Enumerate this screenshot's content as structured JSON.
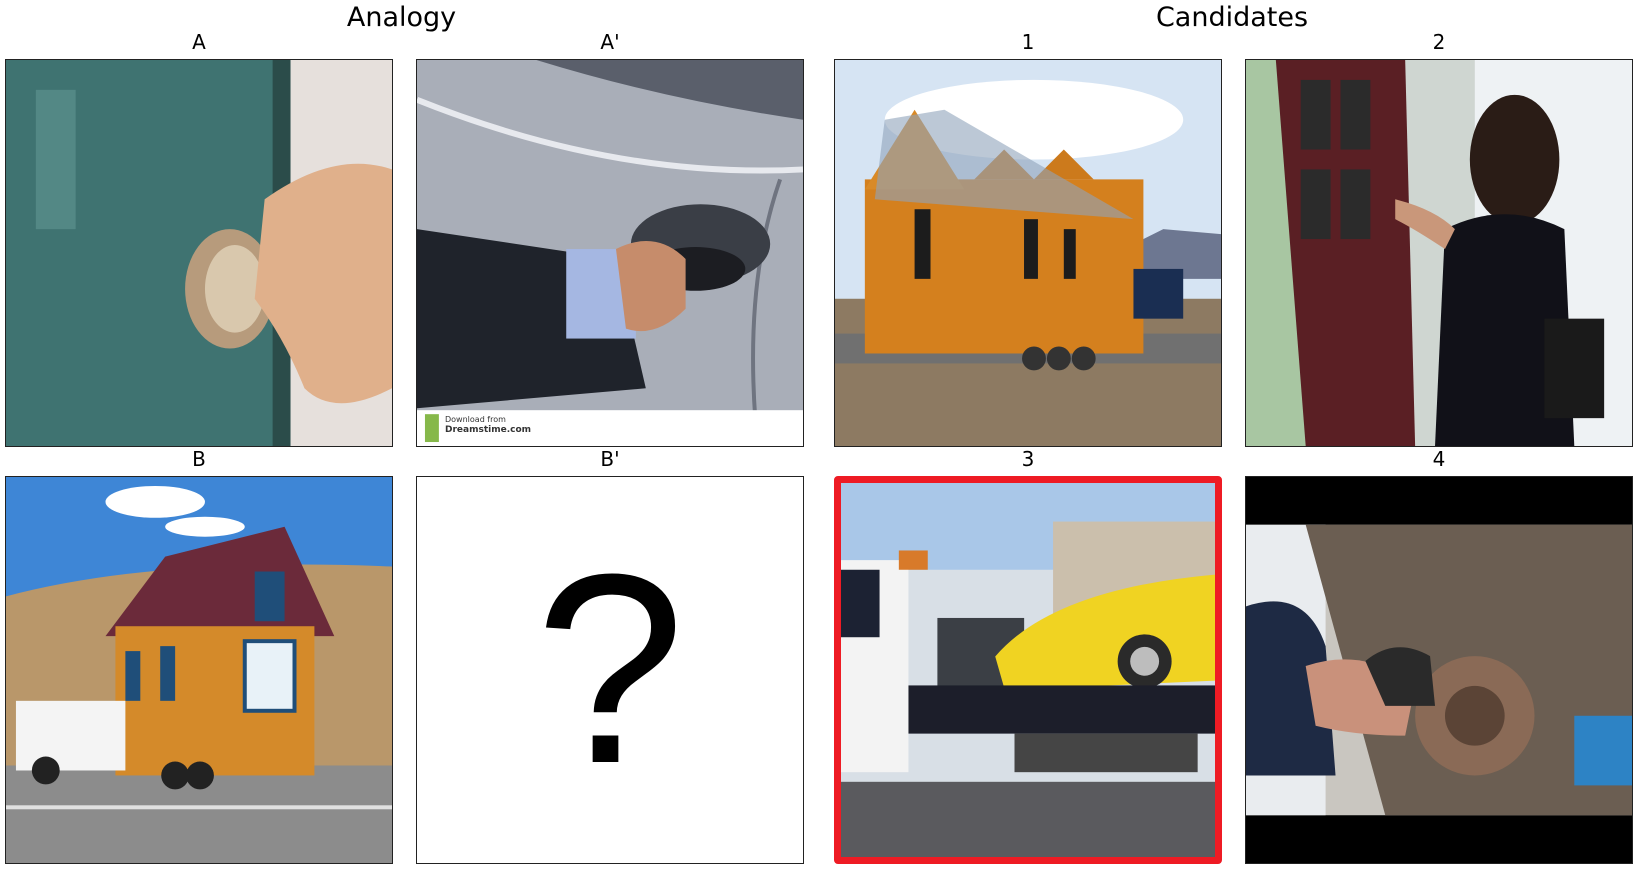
{
  "headers": {
    "analogy": "Analogy",
    "candidates": "Candidates"
  },
  "panels": {
    "a": {
      "label": "A",
      "depicts": "hand turning key in door lock"
    },
    "a_prime": {
      "label": "A'",
      "depicts": "hand unlocking car door with key",
      "watermark": {
        "line1": "Download from",
        "line2": "Dreamstime.com"
      }
    },
    "b": {
      "label": "B",
      "depicts": "pickup truck towing tiny house on trailer"
    },
    "b_prime": {
      "label": "B'",
      "content": "?"
    },
    "c1": {
      "label": "1",
      "depicts": "tiny wooden house on triple-axle trailer towed by truck"
    },
    "c2": {
      "label": "2",
      "depicts": "woman opening a front door"
    },
    "c3": {
      "label": "3",
      "depicts": "flatbed tow truck carrying yellow sports car",
      "selected": true
    },
    "c4": {
      "label": "4",
      "depicts": "hand working on car brake assembly"
    }
  },
  "colors": {
    "selection_border": "#ee1b24",
    "panel_border": "#222222"
  }
}
